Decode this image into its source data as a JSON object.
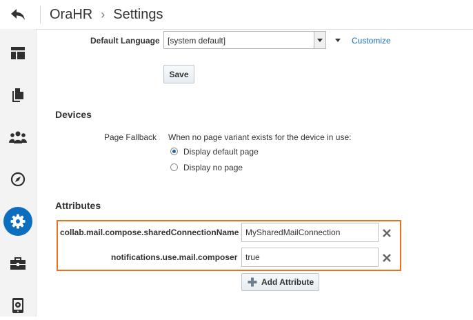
{
  "header": {
    "app_name": "OraHR",
    "separator": "›",
    "page_title": "Settings"
  },
  "nav": {
    "items": [
      {
        "icon": "layout-icon"
      },
      {
        "icon": "documents-icon"
      },
      {
        "icon": "people-icon"
      },
      {
        "icon": "compass-icon"
      },
      {
        "icon": "gear-icon",
        "active": true
      },
      {
        "icon": "toolbox-icon"
      },
      {
        "icon": "mobile-settings-icon"
      }
    ]
  },
  "general": {
    "default_language_label": "Default Language",
    "default_language_value": "[system default]",
    "customize_link": "Customize",
    "save_label": "Save"
  },
  "devices": {
    "title": "Devices",
    "page_fallback_label": "Page Fallback",
    "fallback_description": "When no page variant exists for the device in use:",
    "options": [
      "Display default page",
      "Display no page"
    ],
    "selected": "Display default page"
  },
  "attributes": {
    "title": "Attributes",
    "rows": [
      {
        "name": "collab.mail.compose.sharedConnectionName",
        "value": "MySharedMailConnection"
      },
      {
        "name": "notifications.use.mail.composer",
        "value": "true"
      }
    ],
    "add_label": "Add Attribute"
  },
  "colors": {
    "accent": "#0d6ebf",
    "link": "#1a6fb0",
    "highlight_border": "#e8731f",
    "icon": "#2f2f2f"
  }
}
